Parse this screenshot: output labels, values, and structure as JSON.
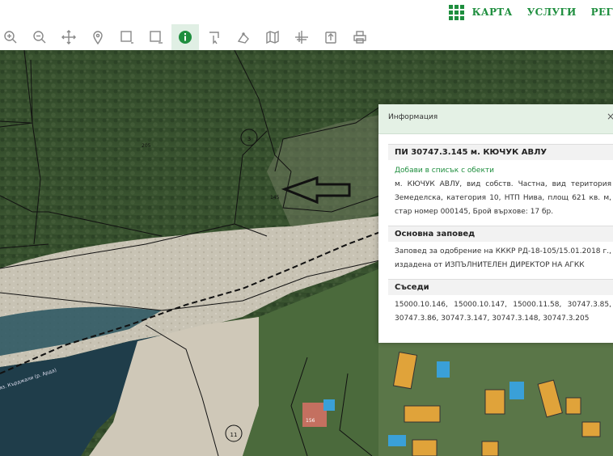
{
  "nav": {
    "karta": "КАРТА",
    "uslugi": "УСЛУГИ",
    "regi": "РЕГ"
  },
  "toolbar": {
    "tools": [
      "zoom-in",
      "zoom-out",
      "pan",
      "location",
      "select-rectangle",
      "select-rectangle-2",
      "info",
      "identify",
      "measure",
      "map-layers",
      "crop",
      "export",
      "print"
    ],
    "active": "info"
  },
  "map_labels": {
    "parcel_3": "3",
    "parcel_11": "11",
    "label_205": "205",
    "label_145": "145",
    "label_156": "156",
    "lake_text": "яз. Кърджали (р. Арда)"
  },
  "panel": {
    "title": "Информация",
    "close": "×",
    "parcel_title": "ПИ 30747.3.145 м. КЮЧУК АВЛУ",
    "add_link": "Добави в списък с обекти",
    "description": "м. КЮЧУК АВЛУ, вид собств. Частна, вид територия Земеделска, категория 10, НТП Нива, площ 621 кв. м, стар номер 000145, Брой върхове: 17 бр.",
    "order_header": "Основна заповед",
    "order_text": "Заповед за одобрение на КККР РД-18-105/15.01.2018 г., издадена от ИЗПЪЛНИТЕЛЕН ДИРЕКТОР НА АГКК",
    "neighbors_header": "Съседи",
    "neighbors_text": "15000.10.146, 15000.10.147, 15000.11.58, 30747.3.85, 30747.3.86, 30747.3.147, 30747.3.148, 30747.3.205"
  },
  "colors": {
    "accent": "#1e8e3e",
    "panel_header_bg": "#e4f1e5"
  }
}
